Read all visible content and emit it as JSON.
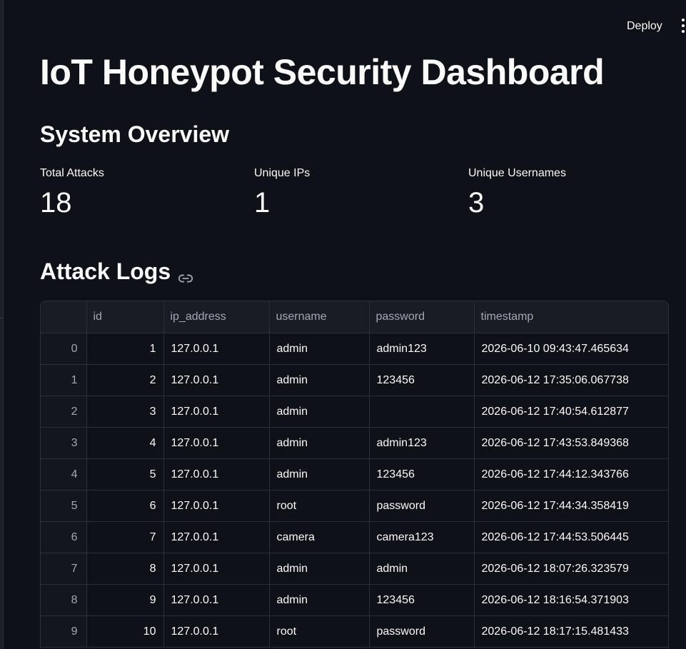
{
  "header": {
    "deploy_label": "Deploy",
    "menu_icon": "more-vertical-icon"
  },
  "page": {
    "title": "IoT Honeypot Security Dashboard"
  },
  "overview": {
    "title": "System Overview",
    "metrics": [
      {
        "label": "Total Attacks",
        "value": "18"
      },
      {
        "label": "Unique IPs",
        "value": "1"
      },
      {
        "label": "Unique Usernames",
        "value": "3"
      }
    ]
  },
  "logs": {
    "title": "Attack Logs",
    "link_icon": "link-icon",
    "columns": [
      "",
      "id",
      "ip_address",
      "username",
      "password",
      "timestamp"
    ],
    "rows": [
      [
        "0",
        "1",
        "127.0.0.1",
        "admin",
        "admin123",
        "2026-06-10 09:43:47.465634"
      ],
      [
        "1",
        "2",
        "127.0.0.1",
        "admin",
        "123456",
        "2026-06-12 17:35:06.067738"
      ],
      [
        "2",
        "3",
        "127.0.0.1",
        "admin",
        "",
        "2026-06-12 17:40:54.612877"
      ],
      [
        "3",
        "4",
        "127.0.0.1",
        "admin",
        "admin123",
        "2026-06-12 17:43:53.849368"
      ],
      [
        "4",
        "5",
        "127.0.0.1",
        "admin",
        "123456",
        "2026-06-12 17:44:12.343766"
      ],
      [
        "5",
        "6",
        "127.0.0.1",
        "root",
        "password",
        "2026-06-12 17:44:34.358419"
      ],
      [
        "6",
        "7",
        "127.0.0.1",
        "camera",
        "camera123",
        "2026-06-12 17:44:53.506445"
      ],
      [
        "7",
        "8",
        "127.0.0.1",
        "admin",
        "admin",
        "2026-06-12 18:07:26.323579"
      ],
      [
        "8",
        "9",
        "127.0.0.1",
        "admin",
        "123456",
        "2026-06-12 18:16:54.371903"
      ],
      [
        "9",
        "10",
        "127.0.0.1",
        "root",
        "password",
        "2026-06-12 18:17:15.481433"
      ]
    ]
  }
}
